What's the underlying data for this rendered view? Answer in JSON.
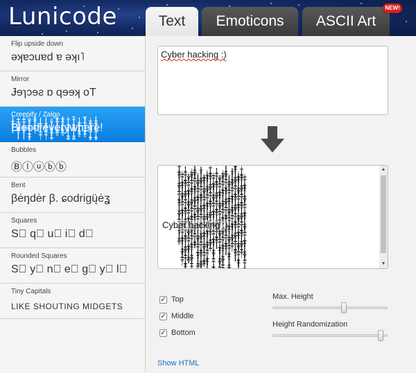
{
  "app": {
    "title": "Lunicode"
  },
  "tabs": [
    {
      "label": "Text",
      "active": true
    },
    {
      "label": "Emoticons",
      "active": false
    },
    {
      "label": "ASCII Art",
      "active": false,
      "badge": "NEW!"
    }
  ],
  "sidebar": {
    "items": [
      {
        "label": "Flip upside down",
        "preview": "ǝʞɐɔuɐd ɐ ǝʞı˥"
      },
      {
        "label": "Mirror",
        "preview": "Ɉɘɿɔɘƨ ɒ qɘɘʞ oT"
      },
      {
        "label": "Creepify / Zalgo",
        "preview": "Blood everywhere!",
        "selected": true
      },
      {
        "label": "Bubbles",
        "preview": "Ⓑⓛⓤⓑⓑ"
      },
      {
        "label": "Bent",
        "preview": "βėŋdėr β. ɕodrigų̈ėʓ"
      },
      {
        "label": "Squares",
        "preview": "S⃞ q⃞ u⃞ i⃞ d⃞"
      },
      {
        "label": "Rounded Squares",
        "preview": "S⃣ y⃣ n⃣ e⃣ g⃣ y⃣ l⃣"
      },
      {
        "label": "Tiny Capitals",
        "preview": "LIKE SHOUTING MIDGETS"
      }
    ]
  },
  "main": {
    "input_text": "Cyber hacking :)",
    "output_text": "Cyber hacking :)",
    "options": [
      {
        "label": "Top",
        "checked": true
      },
      {
        "label": "Middle",
        "checked": true
      },
      {
        "label": "Bottom",
        "checked": true
      }
    ],
    "sliders": [
      {
        "label": "Max. Height",
        "value": 0.63
      },
      {
        "label": "Height Randomization",
        "value": 0.97
      }
    ],
    "show_html_label": "Show HTML"
  },
  "colors": {
    "accent": "#0a7fe0",
    "header_bg": "#142a63",
    "tab_inactive": "#444444",
    "link": "#1a6fc4"
  },
  "icons": {
    "arrow": "arrow-down-icon",
    "checkbox": "checkmark-icon"
  }
}
